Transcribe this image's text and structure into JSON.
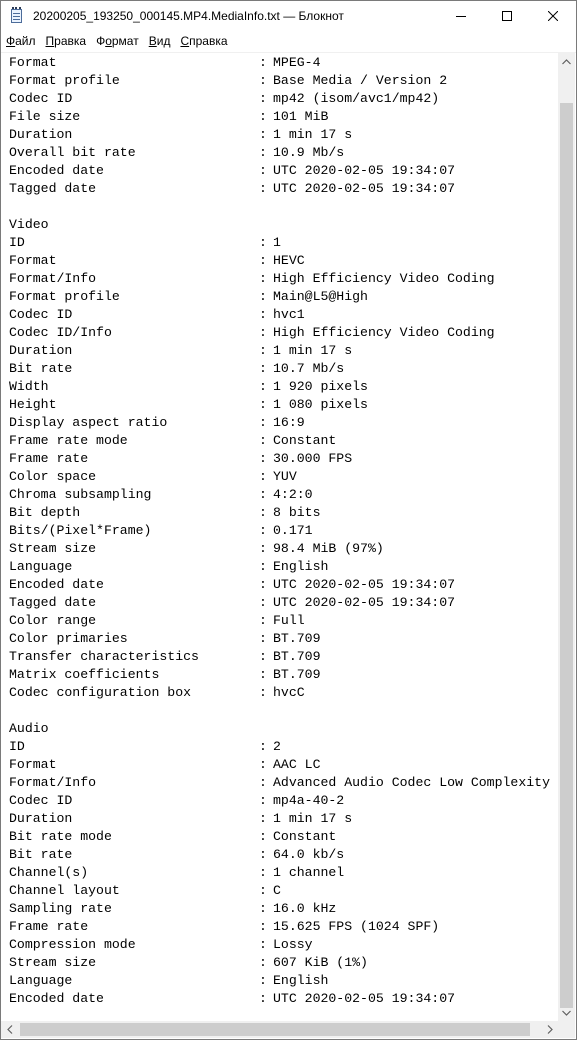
{
  "window": {
    "title": "20200205_193250_000145.MP4.MediaInfo.txt — Блокнот",
    "app_icon": "notepad-icon",
    "controls": {
      "minimize": "minimize-icon",
      "maximize": "maximize-icon",
      "close": "close-icon"
    }
  },
  "menu": [
    {
      "label": "Файл",
      "underline": "Ф",
      "rest": "айл"
    },
    {
      "label": "Правка",
      "underline": "П",
      "rest": "равка"
    },
    {
      "label": "Формат",
      "underline": "о",
      "pre": "Ф",
      "rest": "рмат"
    },
    {
      "label": "Вид",
      "underline": "В",
      "rest": "ид"
    },
    {
      "label": "Справка",
      "underline": "С",
      "rest": "правка"
    }
  ],
  "content": {
    "lines": [
      {
        "key": "Format",
        "value": "MPEG-4"
      },
      {
        "key": "Format profile",
        "value": "Base Media / Version 2"
      },
      {
        "key": "Codec ID",
        "value": "mp42 (isom/avc1/mp42)"
      },
      {
        "key": "File size",
        "value": "101 MiB"
      },
      {
        "key": "Duration",
        "value": "1 min 17 s"
      },
      {
        "key": "Overall bit rate",
        "value": "10.9 Mb/s"
      },
      {
        "key": "Encoded date",
        "value": "UTC 2020-02-05 19:34:07"
      },
      {
        "key": "Tagged date",
        "value": "UTC 2020-02-05 19:34:07"
      },
      {
        "key": "",
        "value": ""
      },
      {
        "section": "Video"
      },
      {
        "key": "ID",
        "value": "1"
      },
      {
        "key": "Format",
        "value": "HEVC"
      },
      {
        "key": "Format/Info",
        "value": "High Efficiency Video Coding"
      },
      {
        "key": "Format profile",
        "value": "Main@L5@High"
      },
      {
        "key": "Codec ID",
        "value": "hvc1"
      },
      {
        "key": "Codec ID/Info",
        "value": "High Efficiency Video Coding"
      },
      {
        "key": "Duration",
        "value": "1 min 17 s"
      },
      {
        "key": "Bit rate",
        "value": "10.7 Mb/s"
      },
      {
        "key": "Width",
        "value": "1 920 pixels"
      },
      {
        "key": "Height",
        "value": "1 080 pixels"
      },
      {
        "key": "Display aspect ratio",
        "value": "16:9"
      },
      {
        "key": "Frame rate mode",
        "value": "Constant"
      },
      {
        "key": "Frame rate",
        "value": "30.000 FPS"
      },
      {
        "key": "Color space",
        "value": "YUV"
      },
      {
        "key": "Chroma subsampling",
        "value": "4:2:0"
      },
      {
        "key": "Bit depth",
        "value": "8 bits"
      },
      {
        "key": "Bits/(Pixel*Frame)",
        "value": "0.171"
      },
      {
        "key": "Stream size",
        "value": "98.4 MiB (97%)"
      },
      {
        "key": "Language",
        "value": "English"
      },
      {
        "key": "Encoded date",
        "value": "UTC 2020-02-05 19:34:07"
      },
      {
        "key": "Tagged date",
        "value": "UTC 2020-02-05 19:34:07"
      },
      {
        "key": "Color range",
        "value": "Full"
      },
      {
        "key": "Color primaries",
        "value": "BT.709"
      },
      {
        "key": "Transfer characteristics",
        "value": "BT.709"
      },
      {
        "key": "Matrix coefficients",
        "value": "BT.709"
      },
      {
        "key": "Codec configuration box",
        "value": "hvcC"
      },
      {
        "key": "",
        "value": ""
      },
      {
        "section": "Audio"
      },
      {
        "key": "ID",
        "value": "2"
      },
      {
        "key": "Format",
        "value": "AAC LC"
      },
      {
        "key": "Format/Info",
        "value": "Advanced Audio Codec Low Complexity"
      },
      {
        "key": "Codec ID",
        "value": "mp4a-40-2"
      },
      {
        "key": "Duration",
        "value": "1 min 17 s"
      },
      {
        "key": "Bit rate mode",
        "value": "Constant"
      },
      {
        "key": "Bit rate",
        "value": "64.0 kb/s"
      },
      {
        "key": "Channel(s)",
        "value": "1 channel"
      },
      {
        "key": "Channel layout",
        "value": "C"
      },
      {
        "key": "Sampling rate",
        "value": "16.0 kHz"
      },
      {
        "key": "Frame rate",
        "value": "15.625 FPS (1024 SPF)"
      },
      {
        "key": "Compression mode",
        "value": "Lossy"
      },
      {
        "key": "Stream size",
        "value": "607 KiB (1%)"
      },
      {
        "key": "Language",
        "value": "English"
      },
      {
        "key": "Encoded date",
        "value": "UTC 2020-02-05 19:34:07"
      }
    ]
  },
  "scrollbars": {
    "vertical": {
      "up": "arrow-up-icon",
      "down": "arrow-down-icon"
    },
    "horizontal": {
      "left": "arrow-left-icon",
      "right": "arrow-right-icon"
    }
  },
  "colors": {
    "titlebar_bg": "#ffffff",
    "scrollbar_track": "#f0f0f0",
    "scrollbar_thumb": "#cdcdcd",
    "text": "#000000"
  }
}
